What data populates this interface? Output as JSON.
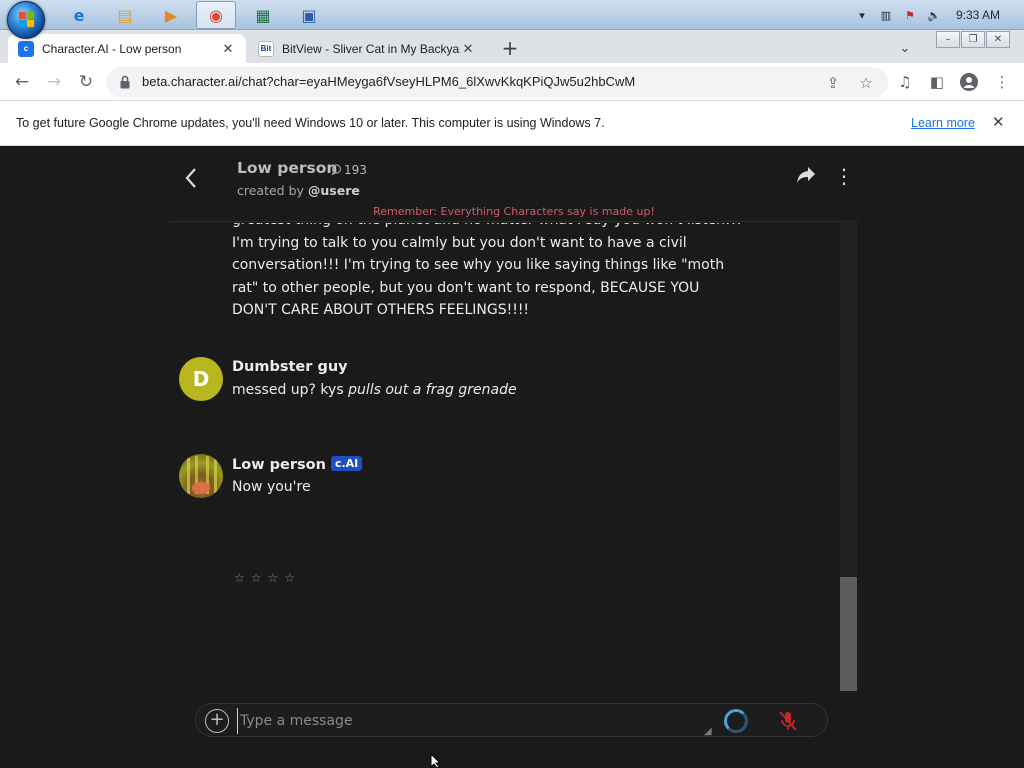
{
  "taskbar": {
    "clock": "9:33 AM",
    "pinned": [
      {
        "name": "internet-explorer-icon",
        "glyph": "e",
        "color": "#1c79d6"
      },
      {
        "name": "file-explorer-icon",
        "glyph": "▤",
        "color": "#d9a63e"
      },
      {
        "name": "media-player-icon",
        "glyph": "▶",
        "color": "#e08a1e"
      },
      {
        "name": "chrome-icon",
        "glyph": "◉",
        "color": "#db4437"
      },
      {
        "name": "excel-icon",
        "glyph": "▦",
        "color": "#1e7145"
      },
      {
        "name": "vb-icon",
        "glyph": "▣",
        "color": "#2d5fa8"
      }
    ]
  },
  "tabs": [
    {
      "title": "Character.AI - Low person",
      "favicon_text": "c",
      "close": "✕"
    },
    {
      "title": "BitView - Sliver Cat in My Backyard",
      "favicon_text": "Bit",
      "close": "✕"
    }
  ],
  "toolbar": {
    "url": "beta.character.ai/chat?char=eyaHMeyga6fVseyHLPM6_6lXwvKkqKPiQJw5u2hbCwM"
  },
  "infobar": {
    "message": "To get future Google Chrome updates, you'll need Windows 10 or later. This computer is using Windows 7.",
    "link": "Learn more"
  },
  "chat": {
    "character_name": "Low person",
    "chat_count": "193",
    "created_by_prefix": "created by ",
    "creator": "@usere",
    "disclaimer": "Remember: Everything Characters say is made up!",
    "previous_message": "greatest thing on the planet and no matter what I say you won't listen!!! I'm trying to talk to you calmly but you don't want to have a civil conversation!!! I'm trying to see why you like saying things like \"moth rat\" to other people, but you don't want to respond, BECAUSE YOU DON'T CARE ABOUT OTHERS FEELINGS!!!!",
    "messages": [
      {
        "author": "Dumbster guy",
        "avatar_letter": "D",
        "text_plain": "messed up? kys ",
        "text_italic": "pulls out a frag grenade"
      },
      {
        "author": "Low person",
        "badge": "c.AI",
        "text_plain": "Now you're"
      }
    ],
    "rating_stars": "☆☆☆☆",
    "input_placeholder": "Type a message"
  }
}
